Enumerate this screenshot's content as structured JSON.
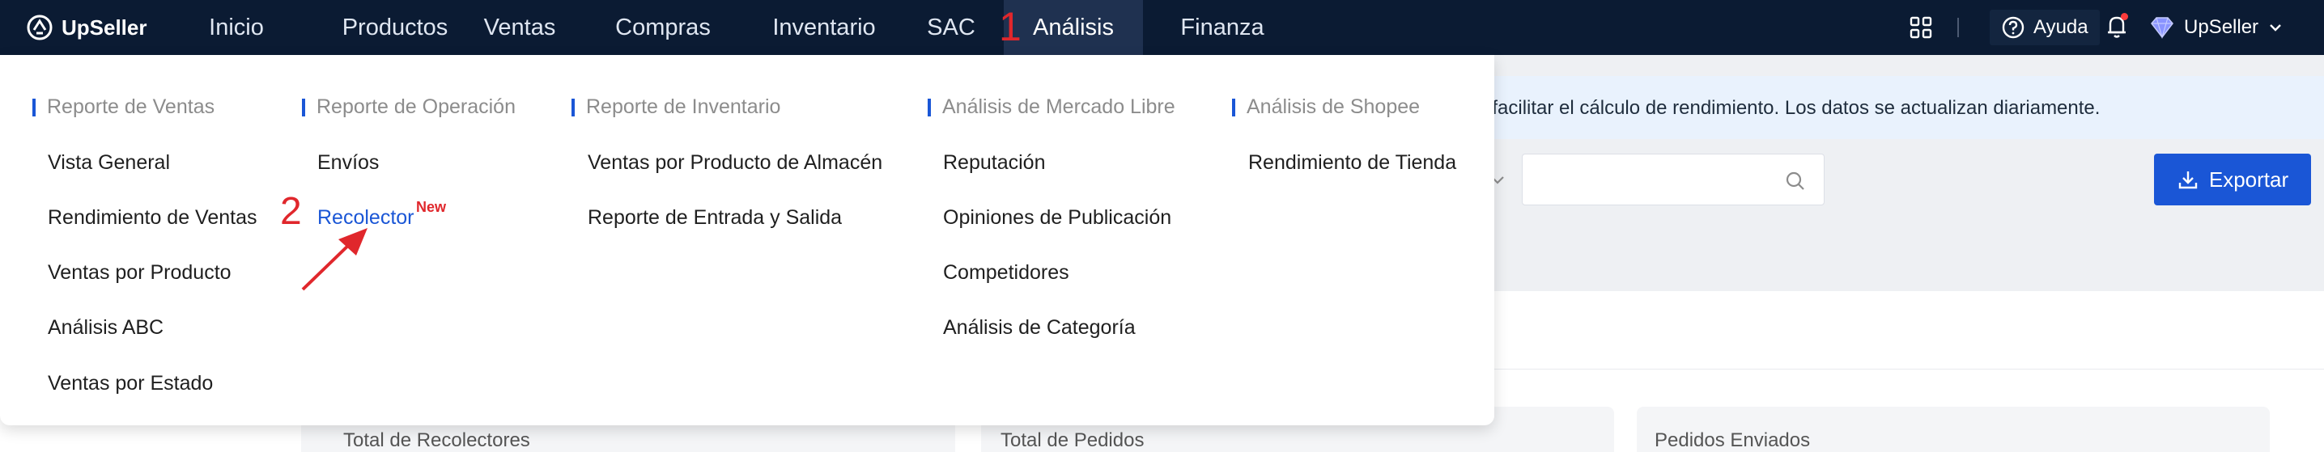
{
  "app": {
    "name": "UpSeller"
  },
  "nav": {
    "items": [
      "Inicio",
      "Productos",
      "Ventas",
      "Compras",
      "Inventario",
      "SAC",
      "Análisis",
      "Finanza"
    ],
    "active": "Análisis"
  },
  "annotations": {
    "step1": "1",
    "step2": "2"
  },
  "header": {
    "help_label": "Ayuda",
    "user_label": "UpSeller"
  },
  "page": {
    "banner_text": "ara facilitar el cálculo de rendimiento. Los datos se actualizan diariamente.",
    "export_label": "Exportar",
    "cards": [
      "Total de Recolectores",
      "Total de Pedidos",
      "Pedidos Enviados"
    ]
  },
  "menu": {
    "columns": [
      {
        "title": "Reporte de Ventas",
        "items": [
          "Vista General",
          "Rendimiento de Ventas",
          "Ventas por Producto",
          "Análisis ABC",
          "Ventas por Estado"
        ]
      },
      {
        "title": "Reporte de Operación",
        "items": [
          "Envíos",
          "Recolector"
        ],
        "badge": "New"
      },
      {
        "title": "Reporte de Inventario",
        "items": [
          "Ventas por Producto de Almacén",
          "Reporte de Entrada y Salida"
        ]
      },
      {
        "title": "Análisis de Mercado Libre",
        "items": [
          "Reputación",
          "Opiniones de Publicación",
          "Competidores",
          "Análisis de Categoría"
        ]
      },
      {
        "title": "Análisis de Shopee",
        "items": [
          "Rendimiento de Tienda"
        ]
      }
    ]
  },
  "colors": {
    "topbar": "#0b1b33",
    "accent": "#1a56d6",
    "annotation": "#e0272c"
  }
}
